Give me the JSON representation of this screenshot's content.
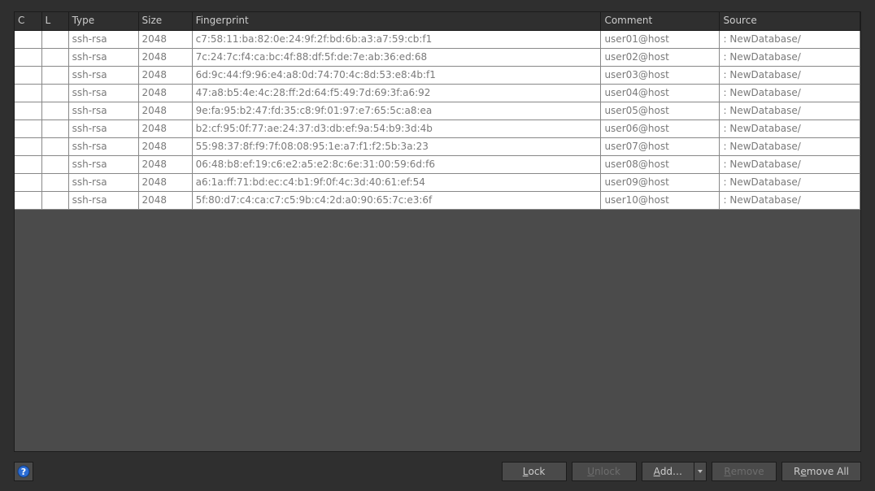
{
  "table": {
    "headers": {
      "c": "C",
      "l": "L",
      "type": "Type",
      "size": "Size",
      "fingerprint": "Fingerprint",
      "comment": "Comment",
      "source": "Source"
    },
    "rows": [
      {
        "c": "",
        "l": "",
        "type": "ssh-rsa",
        "size": "2048",
        "fp": "c7:58:11:ba:82:0e:24:9f:2f:bd:6b:a3:a7:59:cb:f1",
        "comment": "user01@host",
        "source": ": NewDatabase/"
      },
      {
        "c": "",
        "l": "",
        "type": "ssh-rsa",
        "size": "2048",
        "fp": "7c:24:7c:f4:ca:bc:4f:88:df:5f:de:7e:ab:36:ed:68",
        "comment": "user02@host",
        "source": ": NewDatabase/"
      },
      {
        "c": "",
        "l": "",
        "type": "ssh-rsa",
        "size": "2048",
        "fp": "6d:9c:44:f9:96:e4:a8:0d:74:70:4c:8d:53:e8:4b:f1",
        "comment": "user03@host",
        "source": ": NewDatabase/"
      },
      {
        "c": "",
        "l": "",
        "type": "ssh-rsa",
        "size": "2048",
        "fp": "47:a8:b5:4e:4c:28:ff:2d:64:f5:49:7d:69:3f:a6:92",
        "comment": "user04@host",
        "source": ": NewDatabase/"
      },
      {
        "c": "",
        "l": "",
        "type": "ssh-rsa",
        "size": "2048",
        "fp": "9e:fa:95:b2:47:fd:35:c8:9f:01:97:e7:65:5c:a8:ea",
        "comment": "user05@host",
        "source": ": NewDatabase/"
      },
      {
        "c": "",
        "l": "",
        "type": "ssh-rsa",
        "size": "2048",
        "fp": "b2:cf:95:0f:77:ae:24:37:d3:db:ef:9a:54:b9:3d:4b",
        "comment": "user06@host",
        "source": ": NewDatabase/"
      },
      {
        "c": "",
        "l": "",
        "type": "ssh-rsa",
        "size": "2048",
        "fp": "55:98:37:8f:f9:7f:08:08:95:1e:a7:f1:f2:5b:3a:23",
        "comment": "user07@host",
        "source": ": NewDatabase/"
      },
      {
        "c": "",
        "l": "",
        "type": "ssh-rsa",
        "size": "2048",
        "fp": "06:48:b8:ef:19:c6:e2:a5:e2:8c:6e:31:00:59:6d:f6",
        "comment": "user08@host",
        "source": ": NewDatabase/"
      },
      {
        "c": "",
        "l": "",
        "type": "ssh-rsa",
        "size": "2048",
        "fp": "a6:1a:ff:71:bd:ec:c4:b1:9f:0f:4c:3d:40:61:ef:54",
        "comment": "user09@host",
        "source": ": NewDatabase/"
      },
      {
        "c": "",
        "l": "",
        "type": "ssh-rsa",
        "size": "2048",
        "fp": "5f:80:d7:c4:ca:c7:c5:9b:c4:2d:a0:90:65:7c:e3:6f",
        "comment": "user10@host",
        "source": ": NewDatabase/"
      }
    ]
  },
  "buttons": {
    "lock": "ock",
    "lock_u": "L",
    "unlock": "nlock",
    "unlock_u": "U",
    "add": "dd…",
    "add_u": "A",
    "remove": "emove",
    "remove_u": "R",
    "remove_all": "emove All",
    "remove_all_pre": "R"
  }
}
